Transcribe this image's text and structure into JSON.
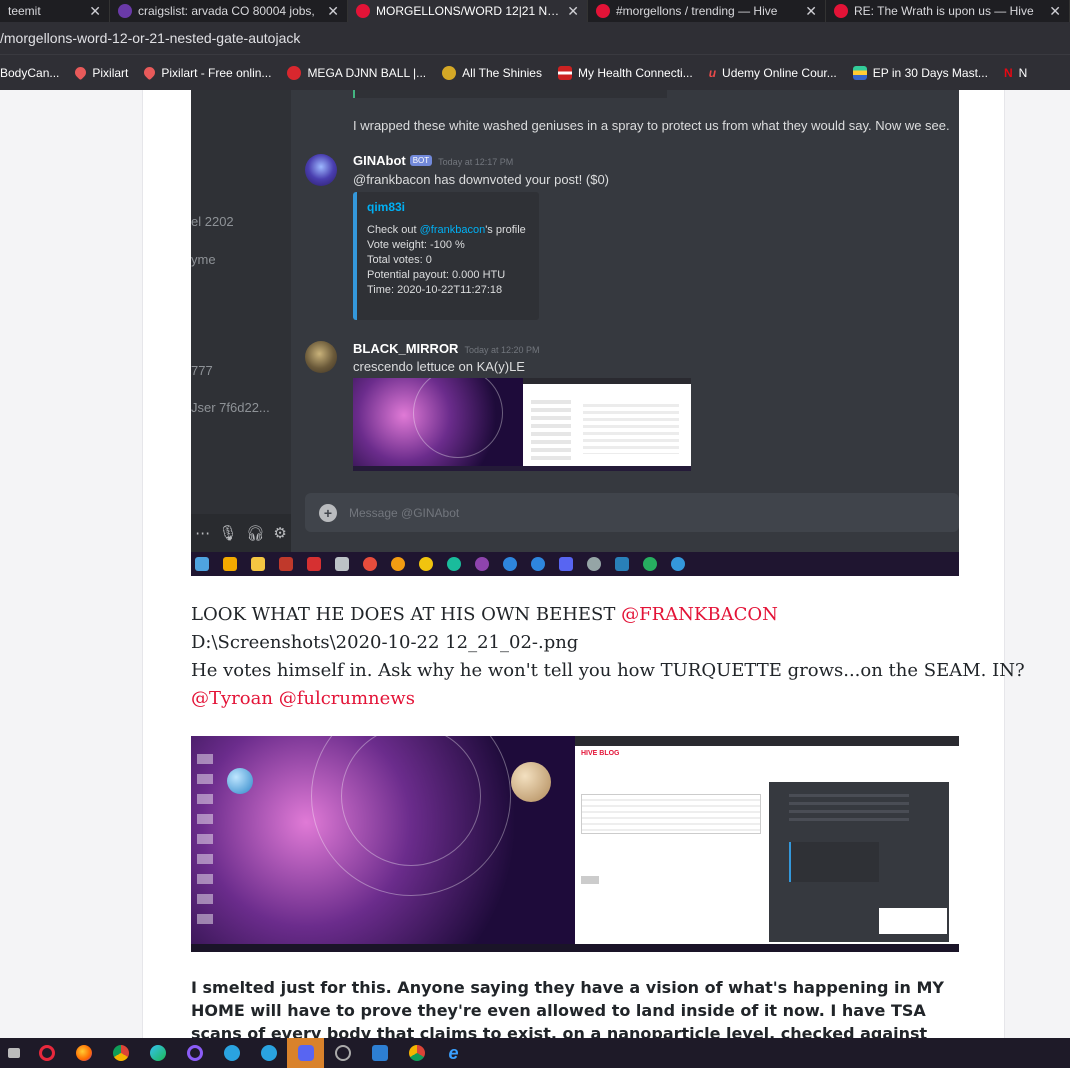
{
  "tabs": [
    {
      "label": "teemit",
      "active": false
    },
    {
      "label": "craigslist: arvada CO 80004 jobs,",
      "active": false
    },
    {
      "label": "MORGELLONS/WORD 12|21 NES",
      "active": true
    },
    {
      "label": "#morgellons / trending — Hive",
      "active": false
    },
    {
      "label": "RE: The Wrath is upon us — Hive",
      "active": false
    }
  ],
  "address": "/morgellons-word-12-or-21-nested-gate-autojack",
  "bookmarks": [
    "BodyCan...",
    "Pixilart",
    "Pixilart - Free onlin...",
    "MEGA DJNN BALL |...",
    "All The Shinies",
    "My Health Connecti...",
    "Udemy Online Cour...",
    "EP in 30 Days Mast...",
    "N"
  ],
  "discord": {
    "channel_fragments": [
      "el 2202",
      "yme",
      "777",
      "Jser 7f6d22..."
    ],
    "top_message": "I wrapped these white washed geniuses in a spray to protect us from what they would say. Now we see.",
    "msg1": {
      "user": "GINAbot",
      "badge": "BOT",
      "time": "Today at 12:17 PM",
      "text": "@frankbacon has downvoted your post! ($0)"
    },
    "embed": {
      "title": "qim83i",
      "checkout_prefix": "Check out ",
      "checkout_link": "@frankbacon",
      "checkout_suffix": "'s profile",
      "lines": [
        "Vote weight: -100 %",
        "Total votes: 0",
        "Potential payout: 0.000 HTU",
        "Time: 2020-10-22T11:27:18"
      ]
    },
    "msg2": {
      "user": "BLACK_MIRROR",
      "time": "Today at 12:20 PM",
      "text": "crescendo lettuce on KA(y)LE"
    },
    "input_placeholder": "Message @GINAbot"
  },
  "post": {
    "line1_text": "LOOK WHAT HE DOES AT HIS OWN BEHEST ",
    "line1_mention": "@FRANKBACON",
    "line2": "D:\\Screenshots\\2020-10-22 12_21_02-.png",
    "line3": "He votes himself in. Ask why he won't tell you how TURQUETTE grows...on the SEAM. IN?",
    "mention_a": "@Tyroan",
    "mention_b": "@fulcrumnews",
    "bold_paragraph": "I smelted just for this. Anyone saying they have a vision of what's happening in MY HOME will have to prove they're even allowed to land inside of it now. I have TSA scans of every body that claims to exist, on a nanoparticle level, checked against your SIM and VIN number to"
  },
  "shot2": {
    "brand": "HIVE BLOG"
  },
  "colors": {
    "hive_red": "#e31337",
    "discord_bg": "#36393f",
    "discord_link": "#00b0f4"
  }
}
